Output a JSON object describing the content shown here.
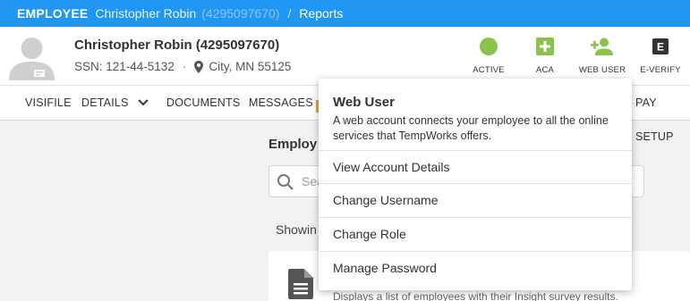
{
  "breadcrumb": {
    "type_label": "EMPLOYEE",
    "employee_name": "Christopher Robin",
    "employee_id": "(4295097670)",
    "separator": "/",
    "page": "Reports"
  },
  "employee": {
    "name": "Christopher Robin (4295097670)",
    "ssn": "SSN: 121-44-5132",
    "separator": "·",
    "location": "City, MN 55125"
  },
  "status_items": [
    {
      "label": "ACTIVE",
      "icon": "active-status-dot-icon",
      "color": "#8bc34a"
    },
    {
      "label": "ACA",
      "icon": "plus-square-icon",
      "color": "#8bc34a"
    },
    {
      "label": "WEB USER",
      "icon": "person-add-icon",
      "color": "#8bc34a"
    },
    {
      "label": "E-VERIFY",
      "icon": "e-verify-badge-icon",
      "color": "#333333"
    }
  ],
  "nav": {
    "items": [
      "VISIFILE",
      "DETAILS",
      "DOCUMENTS",
      "MESSAGES",
      "PAY SETUP"
    ]
  },
  "content": {
    "title": "Employ",
    "search_placeholder": "Sea",
    "showing": "Showin",
    "report_description": "Displays a list of employees with their Insight survey results."
  },
  "popup": {
    "title": "Web User",
    "description": "A web account connects your employee to all the online services that TempWorks offers.",
    "items": [
      "View Account Details",
      "Change Username",
      "Change Role",
      "Manage Password"
    ]
  },
  "colors": {
    "topbar": "#2196f3",
    "accent_green": "#8bc34a"
  }
}
